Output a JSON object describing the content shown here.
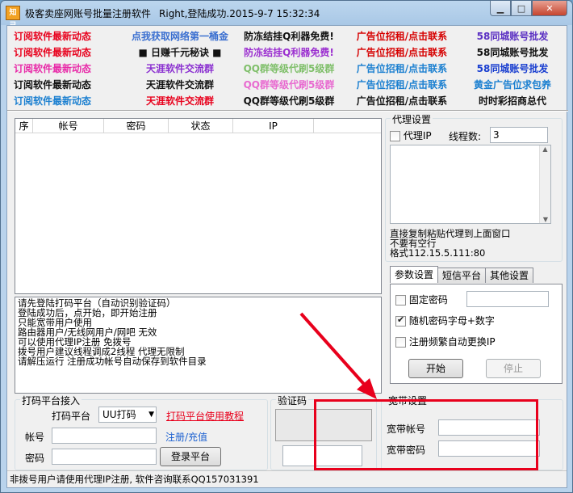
{
  "window": {
    "title": "极客卖座网账号批量注册软件",
    "status_title": "Right,登陆成功.2015-9-7 15:32:34",
    "icon_text": "知己"
  },
  "ads": [
    [
      {
        "t": "订阅软件最新动态",
        "c": "#e8001c"
      },
      {
        "t": "点我获取网络第一桶金",
        "c": "#3a6fd0"
      },
      {
        "t": "防冻结挂Q利器免费!",
        "c": "#111111"
      },
      {
        "t": "广告位招租/点击联系",
        "c": "#d60000"
      },
      {
        "t": "58同城账号批发",
        "c": "#5a2fc2"
      }
    ],
    [
      {
        "t": "订阅软件最新动态",
        "c": "#e8001c"
      },
      {
        "t": "■ 日赚千元秘诀 ■",
        "c": "#111111"
      },
      {
        "t": "防冻结挂Q利器免费!",
        "c": "#9b2fd0"
      },
      {
        "t": "广告位招租/点击联系",
        "c": "#d60000"
      },
      {
        "t": "58同城账号批发",
        "c": "#111111"
      }
    ],
    [
      {
        "t": "订阅软件最新动态",
        "c": "#e82aa8"
      },
      {
        "t": "天涯软件交流群",
        "c": "#8a2fd0"
      },
      {
        "t": "QQ群等级代刷5级群",
        "c": "#7fbf6a"
      },
      {
        "t": "广告位招租/点击联系",
        "c": "#1a7fd0"
      },
      {
        "t": "58同城账号批发",
        "c": "#1a3fd0"
      }
    ],
    [
      {
        "t": "订阅软件最新动态",
        "c": "#111111"
      },
      {
        "t": "天涯软件交流群",
        "c": "#111111"
      },
      {
        "t": "QQ群等级代刷5级群",
        "c": "#e86ad0"
      },
      {
        "t": "广告位招租/点击联系",
        "c": "#1a7fd0"
      },
      {
        "t": "黄金广告位求包养",
        "c": "#1a7fd0"
      }
    ],
    [
      {
        "t": "订阅软件最新动态",
        "c": "#1a7fd0"
      },
      {
        "t": "天涯软件交流群",
        "c": "#e8001c"
      },
      {
        "t": "QQ群等级代刷5级群",
        "c": "#111111"
      },
      {
        "t": "广告位招租/点击联系",
        "c": "#111111"
      },
      {
        "t": "时时彩招商总代",
        "c": "#111111"
      }
    ]
  ],
  "table": {
    "columns": [
      "序",
      "帐号",
      "密码",
      "状态",
      "IP"
    ]
  },
  "log_lines": [
    "请先登陆打码平台（自动识别验证码）",
    "登陆成功后，点开始，即开始注册",
    "只能宽带用户使用",
    "路由器用户/无线网用户/网吧 无效",
    "可以使用代理IP注册 免拨号",
    "拨号用户建议线程调成2线程 代理无限制",
    "请解压运行 注册成功帐号自动保存到软件目录"
  ],
  "proxy": {
    "group_label": "代理设置",
    "proxy_ip_label": "代理IP",
    "threads_label": "线程数:",
    "threads_value": "3",
    "hint1": "直接复制粘贴代理到上面窗口",
    "hint2": "不要有空行",
    "hint3": "格式112.15.5.111:80"
  },
  "tabs": [
    "参数设置",
    "短信平台",
    "其他设置"
  ],
  "params": {
    "fixed_pwd_label": "固定密码",
    "random_pwd_label": "随机密码字母+数字",
    "auto_ip_label": "注册频繁自动更换IP",
    "start_label": "开始",
    "stop_label": "停止"
  },
  "captcha": {
    "group_label": "打码平台接入",
    "platform_label": "打码平台",
    "platform_value": "UU打码",
    "tutorial_link": "打码平台使用教程",
    "account_label": "帐号",
    "register_link": "注册/充值",
    "password_label": "密码",
    "login_button": "登录平台",
    "verify_label": "验证码"
  },
  "broadband": {
    "group_label": "宽带设置",
    "account_label": "宽带帐号",
    "password_label": "宽带密码"
  },
  "status_bar": "非拨号用户请使用代理IP注册, 软件咨询联系QQ157031391",
  "colors": {
    "highlight": "#e8001c",
    "link": "#1a5fd0"
  }
}
